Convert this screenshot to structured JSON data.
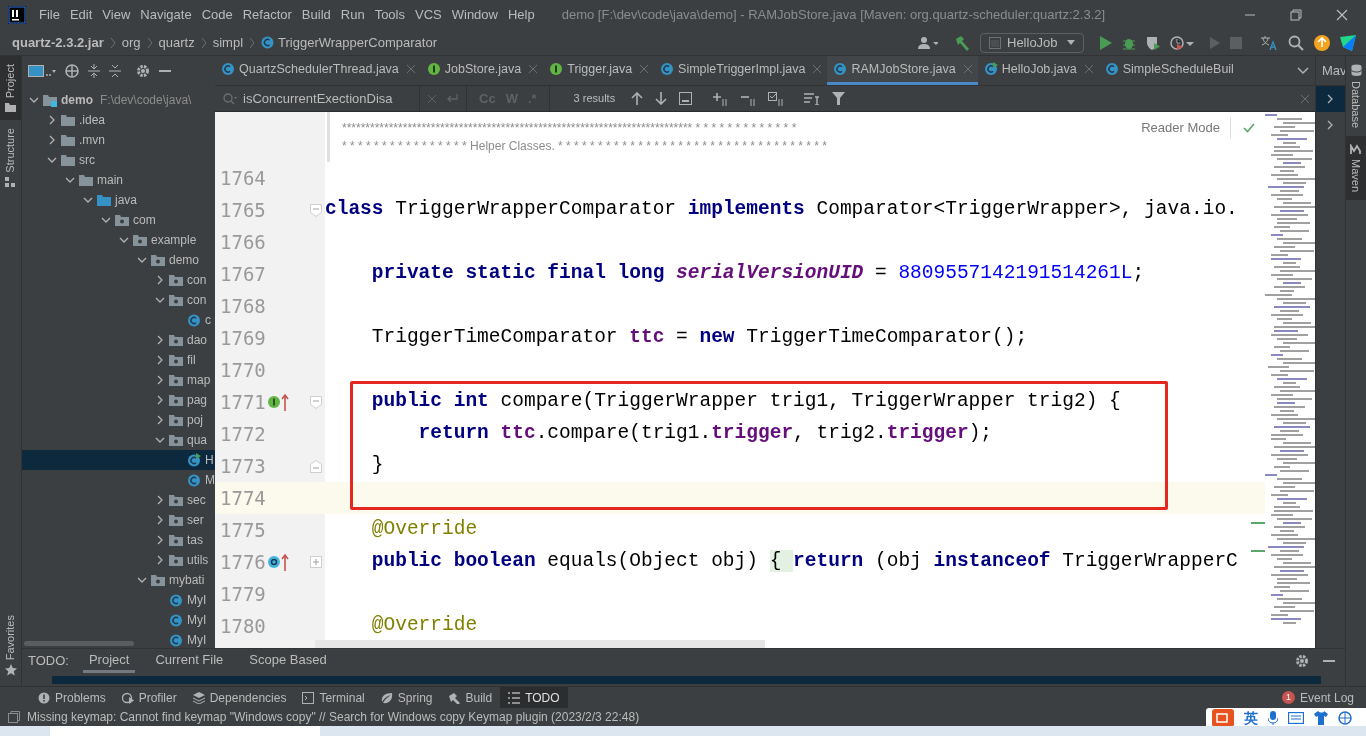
{
  "menu_bar": {
    "items": [
      "File",
      "Edit",
      "View",
      "Navigate",
      "Code",
      "Refactor",
      "Build",
      "Run",
      "Tools",
      "VCS",
      "Window",
      "Help"
    ],
    "window_title": "demo [F:\\dev\\code\\java\\demo] - RAMJobStore.java [Maven: org.quartz-scheduler:quartz:2.3.2]"
  },
  "breadcrumbs": [
    {
      "label": "quartz-2.3.2.jar",
      "kind": "jar"
    },
    {
      "label": "org",
      "kind": "package"
    },
    {
      "label": "quartz",
      "kind": "package"
    },
    {
      "label": "simpl",
      "kind": "package"
    },
    {
      "label": "TriggerWrapperComparator",
      "kind": "class"
    }
  ],
  "run_configuration": "HelloJob",
  "left_tools": [
    {
      "label": "Project",
      "selected": true
    },
    {
      "label": "Structure",
      "selected": false
    }
  ],
  "favorites": "Favorites",
  "project_tree": [
    {
      "label": "demo",
      "path": "F:\\dev\\code\\java\\",
      "kind": "module",
      "expanded": true,
      "selected": false,
      "children": [
        {
          "label": ".idea",
          "kind": "folder",
          "expanded": false,
          "selected": false
        },
        {
          "label": ".mvn",
          "kind": "folder",
          "expanded": false,
          "selected": false
        },
        {
          "label": "src",
          "kind": "folder",
          "expanded": true,
          "selected": false,
          "children": [
            {
              "label": "main",
              "kind": "folder",
              "expanded": true,
              "selected": false,
              "children": [
                {
                  "label": "java",
                  "kind": "source",
                  "expanded": true,
                  "selected": false,
                  "children": [
                    {
                      "label": "com",
                      "kind": "package",
                      "expanded": true,
                      "selected": false,
                      "children": [
                        {
                          "label": "example",
                          "kind": "package",
                          "expanded": true,
                          "selected": false,
                          "children": [
                            {
                              "label": "demo",
                              "kind": "package",
                              "expanded": true,
                              "selected": false,
                              "children": [
                                {
                                  "label": "con",
                                  "kind": "package",
                                  "expanded": false,
                                  "selected": false
                                },
                                {
                                  "label": "con",
                                  "kind": "package",
                                  "expanded": true,
                                  "selected": false,
                                  "children": [
                                    {
                                      "label": "c",
                                      "kind": "class",
                                      "selected": false
                                    }
                                  ]
                                },
                                {
                                  "label": "dao",
                                  "kind": "package",
                                  "expanded": false,
                                  "selected": false
                                },
                                {
                                  "label": "fil",
                                  "kind": "package",
                                  "expanded": false,
                                  "selected": false
                                },
                                {
                                  "label": "map",
                                  "kind": "package",
                                  "expanded": false,
                                  "selected": false
                                },
                                {
                                  "label": "pag",
                                  "kind": "package",
                                  "expanded": false,
                                  "selected": false
                                },
                                {
                                  "label": "poj",
                                  "kind": "package",
                                  "expanded": false,
                                  "selected": false
                                },
                                {
                                  "label": "qua",
                                  "kind": "package",
                                  "expanded": true,
                                  "selected": false,
                                  "children": [
                                    {
                                      "label": "H",
                                      "kind": "class-run",
                                      "selected": true
                                    },
                                    {
                                      "label": "M",
                                      "kind": "class",
                                      "selected": false
                                    }
                                  ]
                                },
                                {
                                  "label": "sec",
                                  "kind": "package",
                                  "expanded": false,
                                  "selected": false
                                },
                                {
                                  "label": "ser",
                                  "kind": "package",
                                  "expanded": false,
                                  "selected": false
                                },
                                {
                                  "label": "tas",
                                  "kind": "package",
                                  "expanded": false,
                                  "selected": false
                                },
                                {
                                  "label": "utils",
                                  "kind": "package",
                                  "expanded": false,
                                  "selected": false
                                }
                              ]
                            },
                            {
                              "label": "mybati",
                              "kind": "package",
                              "expanded": true,
                              "selected": false,
                              "children": [
                                {
                                  "label": "MyI",
                                  "kind": "class",
                                  "selected": false
                                },
                                {
                                  "label": "MyI",
                                  "kind": "class",
                                  "selected": false
                                },
                                {
                                  "label": "MyI",
                                  "kind": "class",
                                  "selected": false
                                }
                              ]
                            }
                          ]
                        }
                      ]
                    }
                  ]
                }
              ]
            }
          ]
        }
      ]
    }
  ],
  "editor_tabs": [
    {
      "label": "QuartzSchedulerThread.java",
      "kind": "class",
      "selected": false
    },
    {
      "label": "JobStore.java",
      "kind": "interface",
      "selected": false
    },
    {
      "label": "Trigger.java",
      "kind": "interface",
      "selected": false
    },
    {
      "label": "SimpleTriggerImpl.java",
      "kind": "class",
      "selected": false
    },
    {
      "label": "RAMJobStore.java",
      "kind": "class",
      "selected": true
    },
    {
      "label": "HelloJob.java",
      "kind": "class-run",
      "selected": false
    },
    {
      "label": "SimpleScheduleBuil",
      "kind": "class",
      "selected": false
    }
  ],
  "find_bar": {
    "value": "isConcurrentExectionDisa",
    "options": [
      "Cc",
      "W",
      ".*"
    ],
    "result_count": "3 results"
  },
  "doc_comment": [
    "*************************************************************************** * * * * * * * * * * * * *",
    "* * * * * * * * * * * * * * * * Helper Classes. * * * * * * * * * * * * * * * * * * * * * * * * * * * * * * * * * *"
  ],
  "reader_mode": "Reader Mode",
  "code_lines": [
    {
      "number": "1764",
      "current": false
    },
    {
      "number": "1765",
      "current": false,
      "fold": {
        "kind": "start"
      },
      "tokens": [
        {
          "text": "class ",
          "kind": "keyword"
        },
        {
          "text": "TriggerWrapperComparator ",
          "kind": "plain"
        },
        {
          "text": "implements ",
          "kind": "keyword"
        },
        {
          "text": "Comparator<TriggerWrapper>, java.io.",
          "kind": "plain"
        }
      ]
    },
    {
      "number": "1766",
      "current": false
    },
    {
      "number": "1767",
      "current": false,
      "tokens": [
        {
          "text": "    private static final long ",
          "kind": "keyword"
        },
        {
          "text": "serialVersionUID",
          "kind": "static-field"
        },
        {
          "text": " = ",
          "kind": "plain"
        },
        {
          "text": "8809557142191514261L",
          "kind": "number"
        },
        {
          "text": ";",
          "kind": "plain"
        }
      ]
    },
    {
      "number": "1768",
      "current": false
    },
    {
      "number": "1769",
      "current": false,
      "tokens": [
        {
          "text": "    TriggerTimeComparator ",
          "kind": "plain"
        },
        {
          "text": "ttc",
          "kind": "field"
        },
        {
          "text": " = ",
          "kind": "plain"
        },
        {
          "text": "new ",
          "kind": "keyword"
        },
        {
          "text": "TriggerTimeComparator();",
          "kind": "plain"
        }
      ]
    },
    {
      "number": "1770",
      "current": false
    },
    {
      "number": "1771",
      "current": false,
      "fold": {
        "kind": "start"
      },
      "marker": {
        "kind": "implements"
      },
      "tokens": [
        {
          "text": "    public int ",
          "kind": "keyword"
        },
        {
          "text": "compare(TriggerWrapper trig1, TriggerWrapper trig2) {",
          "kind": "plain"
        }
      ]
    },
    {
      "number": "1772",
      "current": false,
      "tokens": [
        {
          "text": "        return ",
          "kind": "keyword"
        },
        {
          "text": "ttc",
          "kind": "field"
        },
        {
          "text": ".compare(trig1.",
          "kind": "plain"
        },
        {
          "text": "trigger",
          "kind": "field"
        },
        {
          "text": ", trig2.",
          "kind": "plain"
        },
        {
          "text": "trigger",
          "kind": "field"
        },
        {
          "text": ");",
          "kind": "plain"
        }
      ]
    },
    {
      "number": "1773",
      "current": false,
      "fold": {
        "kind": "end"
      },
      "tokens": [
        {
          "text": "    }",
          "kind": "plain"
        }
      ]
    },
    {
      "number": "1774",
      "current": true
    },
    {
      "number": "1775",
      "current": false,
      "tokens": [
        {
          "text": "    @Override",
          "kind": "annotation"
        }
      ]
    },
    {
      "number": "1776",
      "current": false,
      "fold": {
        "kind": "collapsed"
      },
      "marker": {
        "kind": "overrides"
      },
      "tokens": [
        {
          "text": "    public boolean ",
          "kind": "keyword"
        },
        {
          "text": "equals(Object obj) ",
          "kind": "plain"
        },
        {
          "text": "{ ",
          "kind": "folded"
        },
        {
          "text": "return ",
          "kind": "keyword"
        },
        {
          "text": "(obj ",
          "kind": "plain"
        },
        {
          "text": "instanceof ",
          "kind": "keyword"
        },
        {
          "text": "TriggerWrapperC",
          "kind": "plain"
        }
      ]
    },
    {
      "number": "1779",
      "current": false
    },
    {
      "number": "1780",
      "current": false,
      "tokens": [
        {
          "text": "    @Override",
          "kind": "annotation"
        }
      ]
    }
  ],
  "maven_panel": {
    "title": "Mav"
  },
  "right_tools": [
    {
      "label": "Database",
      "selected": false
    },
    {
      "label": "Maven",
      "selected": true
    }
  ],
  "todo_panel": {
    "label": "TODO:",
    "tabs": [
      {
        "label": "Project",
        "selected": true
      },
      {
        "label": "Current File",
        "selected": false
      },
      {
        "label": "Scope Based",
        "selected": false
      }
    ]
  },
  "tool_windows": [
    {
      "label": "Problems",
      "kind": "problems",
      "selected": false
    },
    {
      "label": "Profiler",
      "kind": "profiler",
      "selected": false
    },
    {
      "label": "Dependencies",
      "kind": "dependencies",
      "selected": false
    },
    {
      "label": "Terminal",
      "kind": "terminal",
      "selected": false
    },
    {
      "label": "Spring",
      "kind": "spring",
      "selected": false
    },
    {
      "label": "Build",
      "kind": "build",
      "selected": false
    },
    {
      "label": "TODO",
      "kind": "todo",
      "selected": true
    }
  ],
  "event_log": {
    "label": "Event Log",
    "count": "1"
  },
  "status_message": "Missing keymap: Cannot find keymap \"Windows copy\" // Search for Windows copy Keymap plugin (2023/2/3 22:48)",
  "ime_bar": {
    "language": "英"
  }
}
